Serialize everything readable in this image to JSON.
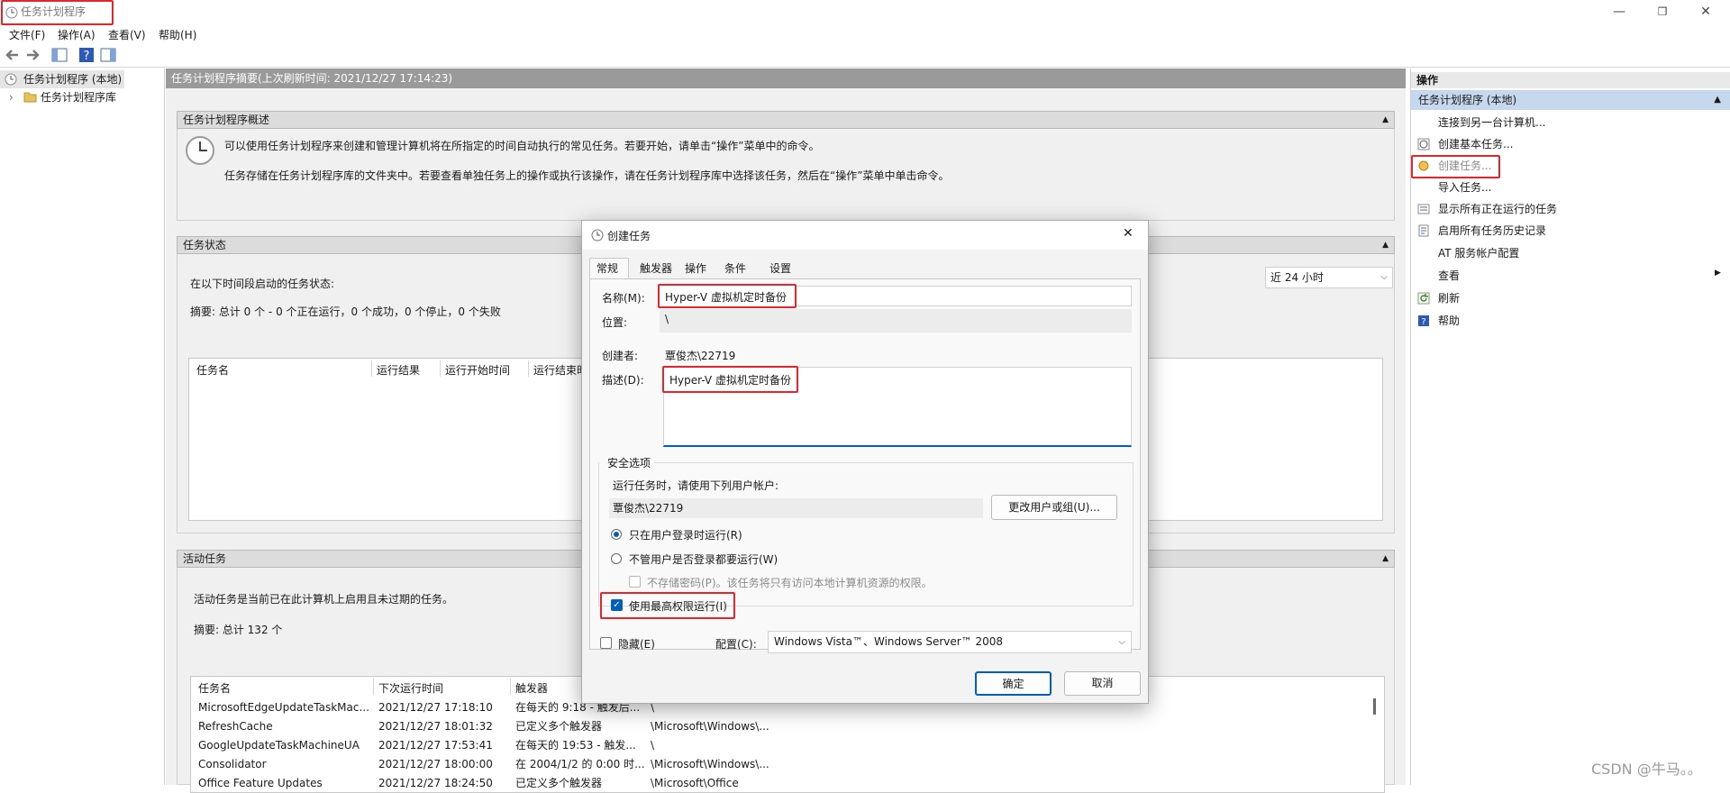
{
  "window": {
    "title": "任务计划程序",
    "min_label": "—",
    "max_label": "❐",
    "close_label": "✕"
  },
  "menu": [
    "文件(F)",
    "操作(A)",
    "查看(V)",
    "帮助(H)"
  ],
  "tree": {
    "root": "任务计划程序 (本地)",
    "library": "任务计划程序库",
    "expand_glyph": "›"
  },
  "center": {
    "header": "任务计划程序摘要(上次刷新时间: 2021/12/27 17:14:23)",
    "overview": {
      "title": "任务计划程序概述",
      "line1": "可以使用任务计划程序来创建和管理计算机将在所指定的时间自动执行的常见任务。若要开始，请单击“操作”菜单中的命令。",
      "line2": "任务存储在任务计划程序库的文件夹中。若要查看单独任务上的操作或执行该操作，请在任务计划程序库中选择该任务，然后在“操作”菜单中单击命令。"
    },
    "status": {
      "title": "任务状态",
      "period_label": "在以下时间段启动的任务状态:",
      "period_value": "近 24 小时",
      "summary": "摘要: 总计 0 个 - 0 个正在运行，0 个成功，0 个停止，0 个失败",
      "columns": [
        "任务名",
        "运行结果",
        "运行开始时间",
        "运行结束时"
      ]
    },
    "active": {
      "title": "活动任务",
      "desc": "活动任务是当前已在此计算机上启用且未过期的任务。",
      "summary": "摘要: 总计 132 个",
      "columns": [
        "任务名",
        "下次运行时间",
        "触发器"
      ],
      "rows": [
        [
          "MicrosoftEdgeUpdateTaskMac...",
          "2021/12/27 17:18:10",
          "在每天的 9:18 - 触发后...",
          "\\"
        ],
        [
          "RefreshCache",
          "2021/12/27 18:01:32",
          "已定义多个触发器",
          "\\Microsoft\\Windows\\..."
        ],
        [
          "GoogleUpdateTaskMachineUA",
          "2021/12/27 17:53:41",
          "在每天的 19:53 - 触发...",
          "\\"
        ],
        [
          "Consolidator",
          "2021/12/27 18:00:00",
          "在 2004/1/2 的 0:00 时...",
          "\\Microsoft\\Windows\\..."
        ],
        [
          "Office Feature Updates",
          "2021/12/27 18:24:50",
          "已定义多个触发器",
          "\\Microsoft\\Office"
        ]
      ]
    }
  },
  "actions": {
    "header": "操作",
    "group": "任务计划程序 (本地)",
    "group_glyph": "▲",
    "submenu_glyph": "▶",
    "items": [
      "连接到另一台计算机...",
      "创建基本任务...",
      "创建任务...",
      "导入任务...",
      "显示所有正在运行的任务",
      "启用所有任务历史记录",
      "AT 服务帐户配置",
      "查看",
      "刷新",
      "帮助"
    ]
  },
  "dialog": {
    "title": "创建任务",
    "close_glyph": "✕",
    "tabs": [
      "常规",
      "触发器",
      "操作",
      "条件",
      "设置"
    ],
    "name_label": "名称(M):",
    "name_value": "Hyper-V 虚拟机定时备份",
    "location_label": "位置:",
    "location_value": "\\",
    "author_label": "创建者:",
    "author_value": "覃俊杰\\22719",
    "desc_label": "描述(D):",
    "desc_value": "Hyper-V 虚拟机定时备份",
    "security": {
      "title": "安全选项",
      "run_as_label": "运行任务时，请使用下列用户帐户:",
      "user": "覃俊杰\\22719",
      "change_button": "更改用户或组(U)...",
      "opt_logged_on": "只在用户登录时运行(R)",
      "opt_whether": "不管用户是否登录都要运行(W)",
      "no_store_pwd": "不存储密码(P)。该任务将只有访问本地计算机资源的权限。",
      "highest": "使用最高权限运行(I)"
    },
    "hidden_label": "隐藏(E)",
    "config_label": "配置(C):",
    "config_value": "Windows Vista™、Windows Server™ 2008",
    "ok": "确定",
    "cancel": "取消"
  },
  "watermark": "CSDN @牛马。。"
}
